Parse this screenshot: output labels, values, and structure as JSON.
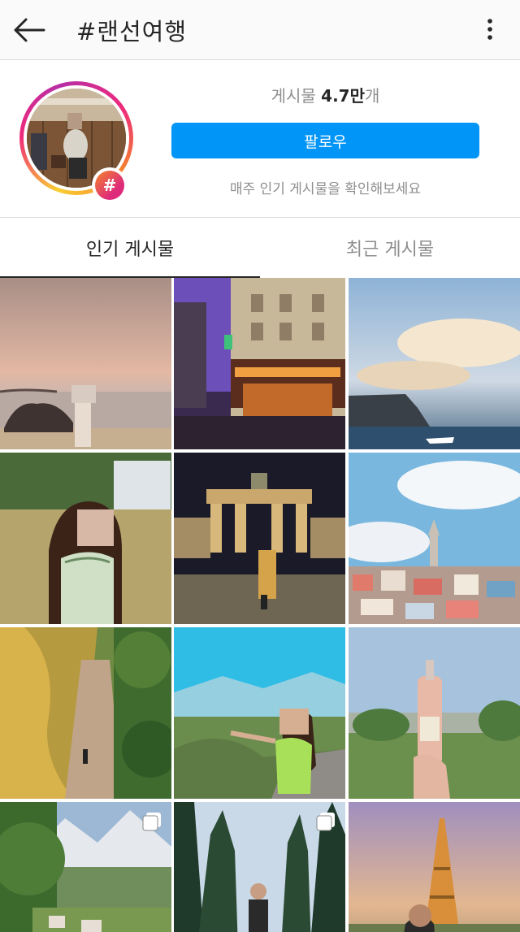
{
  "header": {
    "title": "#랜선여행",
    "back_icon": "arrow-left-icon",
    "more_icon": "more-vertical-icon"
  },
  "profile": {
    "posts_label": "게시물",
    "posts_count": "4.7만",
    "posts_suffix": "개",
    "follow_label": "팔로우",
    "hashtag_badge": "#",
    "subtitle": "매주 인기 게시물을 확인해보세요"
  },
  "tabs": {
    "top": "인기 게시물",
    "recent": "최근 게시물"
  },
  "colors": {
    "follow_button": "#0095f6",
    "text_primary": "#262626",
    "text_secondary": "#8e8e8e",
    "divider": "#dbdbdb"
  }
}
